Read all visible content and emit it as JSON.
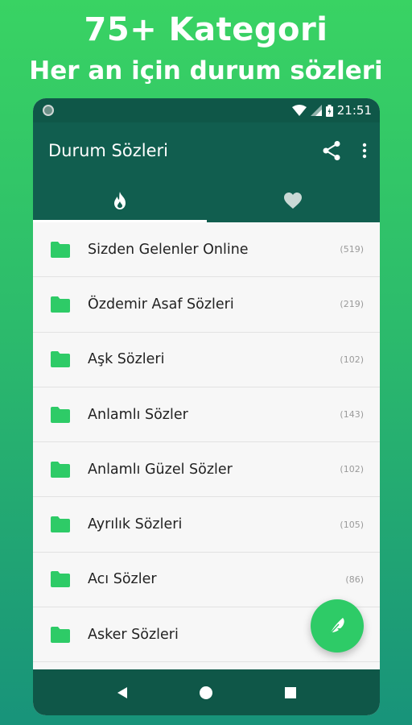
{
  "promo": {
    "title": "75+ Kategori",
    "subtitle": "Her an için durum sözleri"
  },
  "status_bar": {
    "time": "21:51"
  },
  "app_bar": {
    "title": "Durum Sözleri",
    "actions": [
      "share-icon",
      "more-vert-icon"
    ]
  },
  "tabs": [
    {
      "icon": "fire-icon",
      "selected": true
    },
    {
      "icon": "heart-icon",
      "selected": false
    }
  ],
  "categories": [
    {
      "label": "Sizden Gelenler Online",
      "count": "(519)"
    },
    {
      "label": "Özdemir Asaf Sözleri",
      "count": "(219)"
    },
    {
      "label": "Aşk Sözleri",
      "count": "(102)"
    },
    {
      "label": "Anlamlı Sözler",
      "count": "(143)"
    },
    {
      "label": "Anlamlı Güzel Sözler",
      "count": "(102)"
    },
    {
      "label": "Ayrılık Sözleri",
      "count": "(105)"
    },
    {
      "label": "Acı Sözler",
      "count": "(86)"
    },
    {
      "label": "Asker Sözleri",
      "count": ""
    }
  ],
  "fab": {
    "icon": "feather-icon"
  },
  "colors": {
    "primary": "#115e4f",
    "accent": "#2ecb67",
    "folder": "#2ecb67"
  }
}
